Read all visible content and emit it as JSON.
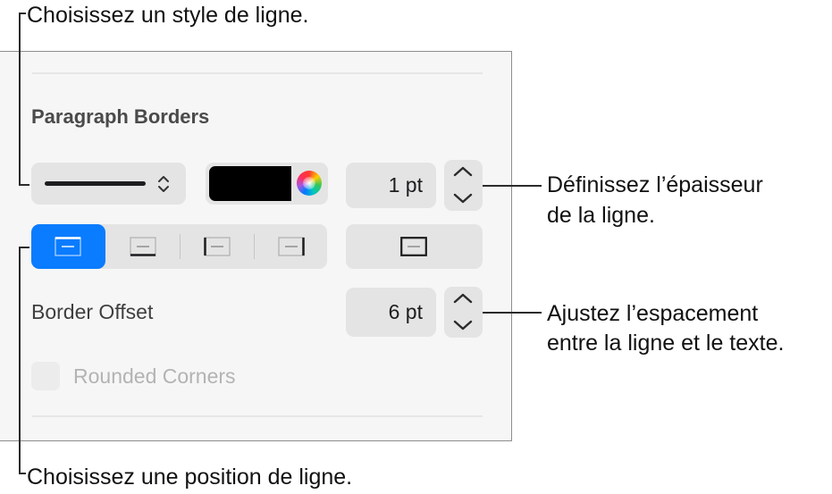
{
  "callouts": {
    "style": "Choisissez un style de ligne.",
    "thickness_line1": "Définissez l’épaisseur",
    "thickness_line2": "de la ligne.",
    "spacing_line1": "Ajustez l’espacement",
    "spacing_line2": "entre la ligne et le texte.",
    "position": "Choisissez une position de ligne."
  },
  "panel": {
    "section_title": "Paragraph Borders",
    "line_style": {
      "selected": "solid-line",
      "icon": "chevron-up-down-icon"
    },
    "color_well": {
      "color": "#000000",
      "picker_icon": "color-wheel-icon"
    },
    "thickness": {
      "value": "1 pt"
    },
    "position_buttons": [
      {
        "name": "top",
        "selected": true
      },
      {
        "name": "bottom",
        "selected": false
      },
      {
        "name": "left",
        "selected": false
      },
      {
        "name": "right",
        "selected": false
      }
    ],
    "all_sides_button": {
      "name": "box-all-sides"
    },
    "border_offset": {
      "label": "Border Offset",
      "value": "6 pt"
    },
    "rounded_corners": {
      "label": "Rounded Corners",
      "checked": false,
      "enabled": false
    }
  },
  "colors": {
    "accent": "#0a7cff",
    "control_bg": "#e4e4e4",
    "panel_bg": "#f6f6f6"
  }
}
